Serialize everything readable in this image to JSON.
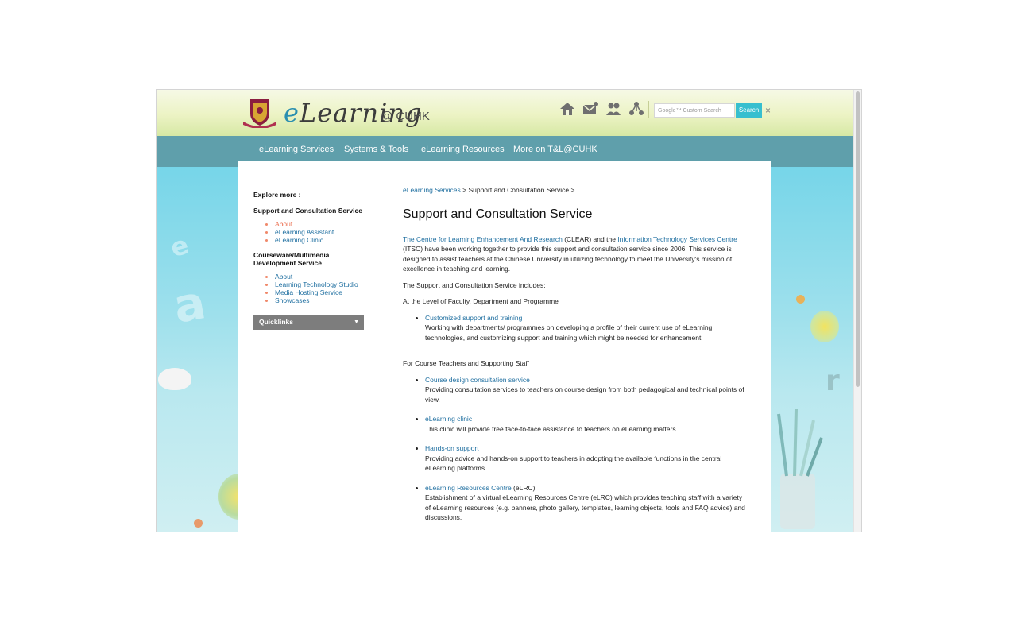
{
  "header": {
    "brand_script": "Learning",
    "brand_e": "e",
    "brand_suffix": "@ CUHK",
    "icons": [
      "home-icon",
      "mail-icon",
      "people-icon",
      "sitemap-icon"
    ],
    "search_placeholder": "Google™ Custom Search",
    "search_button": "Search",
    "close_glyph": "×"
  },
  "nav": {
    "items": [
      "eLearning Services",
      "Systems & Tools",
      "eLearning Resources",
      "More on T&L@CUHK"
    ]
  },
  "sidebar": {
    "explore": "Explore more :",
    "group1_title": "Support and Consultation Service",
    "group1_items": [
      "About",
      "eLearning Assistant",
      "eLearning Clinic"
    ],
    "group2_title": "Courseware/Multimedia Development Service",
    "group2_items": [
      "About",
      "Learning Technology Studio",
      "Media Hosting Service",
      "Showcases"
    ],
    "quicklinks": "Quicklinks"
  },
  "content": {
    "breadcrumb_link": "eLearning Services",
    "breadcrumb_rest": " > Support and Consultation Service >",
    "title": "Support and Consultation Service",
    "intro": {
      "link1": "The Centre for Learning Enhancement And Research",
      "text1": " (CLEAR) and the ",
      "link2": "Information Technology Services Centre",
      "text2": " (ITSC) have been working together to provide this support and consultation service since 2006. This service is designed to assist teachers at the Chinese University in utilizing technology to meet the University's mission of excellence in teaching and learning."
    },
    "includes": "The Support and Consultation Service includes:",
    "level1": "At the Level of Faculty, Department and Programme",
    "item1_title": "Customized support and training",
    "item1_text": "Working with departments/ programmes on developing a profile of their current use of eLearning technologies, and customizing support and training which might be needed for enhancement.",
    "level2": "For Course Teachers and Supporting Staff",
    "item2_title": "Course design consultation service",
    "item2_text": "Providing consultation services to teachers on course design from both pedagogical and technical points of view.",
    "item3_title": "eLearning clinic",
    "item3_text": "This clinic will provide free face-to-face assistance to teachers on eLearning matters.",
    "item4_title": "Hands-on support",
    "item4_text": "Providing advice and hands-on support to teachers in adopting the available functions in the central eLearning platforms.",
    "item5_title": "eLearning Resources Centre",
    "item5_suffix": " (eLRC)",
    "item5_text": "Establishment of a virtual eLearning Resources Centre (eLRC) which provides teaching staff with a variety of eLearning resources (e.g. banners, photo gallery, templates, learning objects, tools and FAQ advice) and discussions."
  },
  "colors": {
    "nav": "#5f9fab",
    "link": "#1f6fa0",
    "active": "#ea6a4a",
    "search_button": "#37bfcf"
  }
}
